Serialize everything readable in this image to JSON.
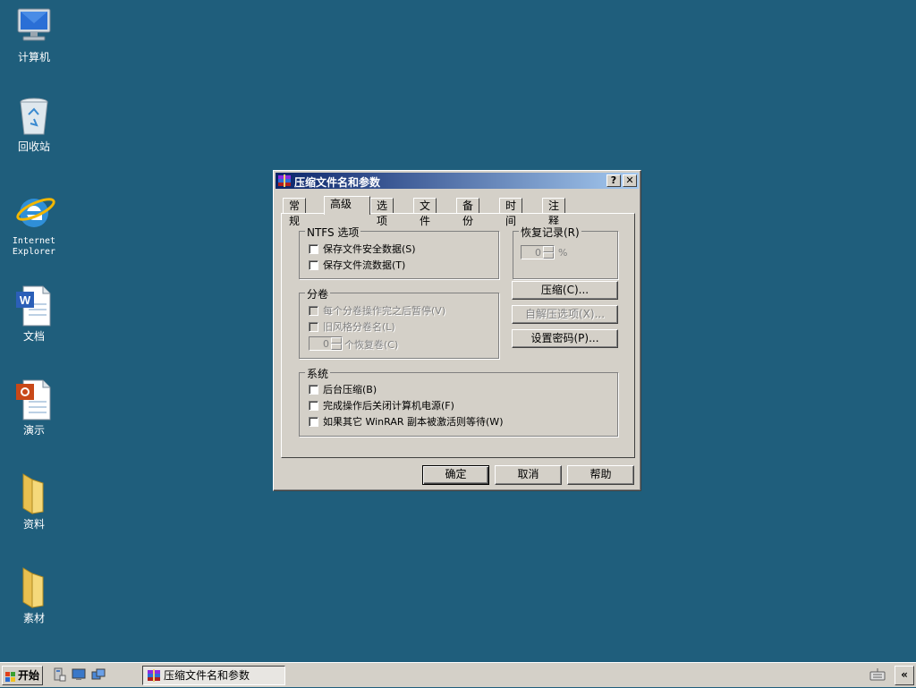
{
  "desktop": {
    "icons": [
      {
        "label": "计算机",
        "icon": "computer-icon"
      },
      {
        "label": "回收站",
        "icon": "recycle-bin-icon"
      },
      {
        "label": "Internet\nExplorer",
        "icon": "internet-explorer-icon"
      },
      {
        "label": "文档",
        "icon": "word-document-icon"
      },
      {
        "label": "演示",
        "icon": "powerpoint-document-icon"
      },
      {
        "label": "资料",
        "icon": "folder-icon"
      },
      {
        "label": "素材",
        "icon": "folder-icon"
      }
    ]
  },
  "dialog": {
    "title": "压缩文件名和参数",
    "help_btn": "?",
    "close_btn": "✕",
    "tabs": [
      "常规",
      "高级",
      "选项",
      "文件",
      "备份",
      "时间",
      "注释"
    ],
    "active_tab": "高级",
    "ntfs": {
      "title": "NTFS 选项",
      "save_security": "保存文件安全数据(S)",
      "save_streams": "保存文件流数据(T)"
    },
    "recovery": {
      "title": "恢复记录(R)",
      "value": "0",
      "unit": "%"
    },
    "volume": {
      "title": "分卷",
      "pause_after_each": "每个分卷操作完之后暂停(V)",
      "old_style_naming": "旧风格分卷名(L)",
      "recovery_volumes_value": "0",
      "recovery_volumes_label": "个恢复卷(C)"
    },
    "buttons_right": {
      "compress": "压缩(C)...",
      "sfx_options": "自解压选项(X)...",
      "set_password": "设置密码(P)..."
    },
    "system": {
      "title": "系统",
      "background": "后台压缩(B)",
      "shutdown": "完成操作后关闭计算机电源(F)",
      "wait_other": "如果其它 WinRAR 副本被激活则等待(W)"
    },
    "footer": {
      "ok": "确定",
      "cancel": "取消",
      "help": "帮助"
    }
  },
  "taskbar": {
    "start_label": "开始",
    "task_label": "压缩文件名和参数",
    "tray_toggle": "«"
  },
  "colors": {
    "desktop_bg": "#1f5e7c",
    "title_start": "#0a246a",
    "title_end": "#a6caf0",
    "face": "#d4d0c8"
  }
}
